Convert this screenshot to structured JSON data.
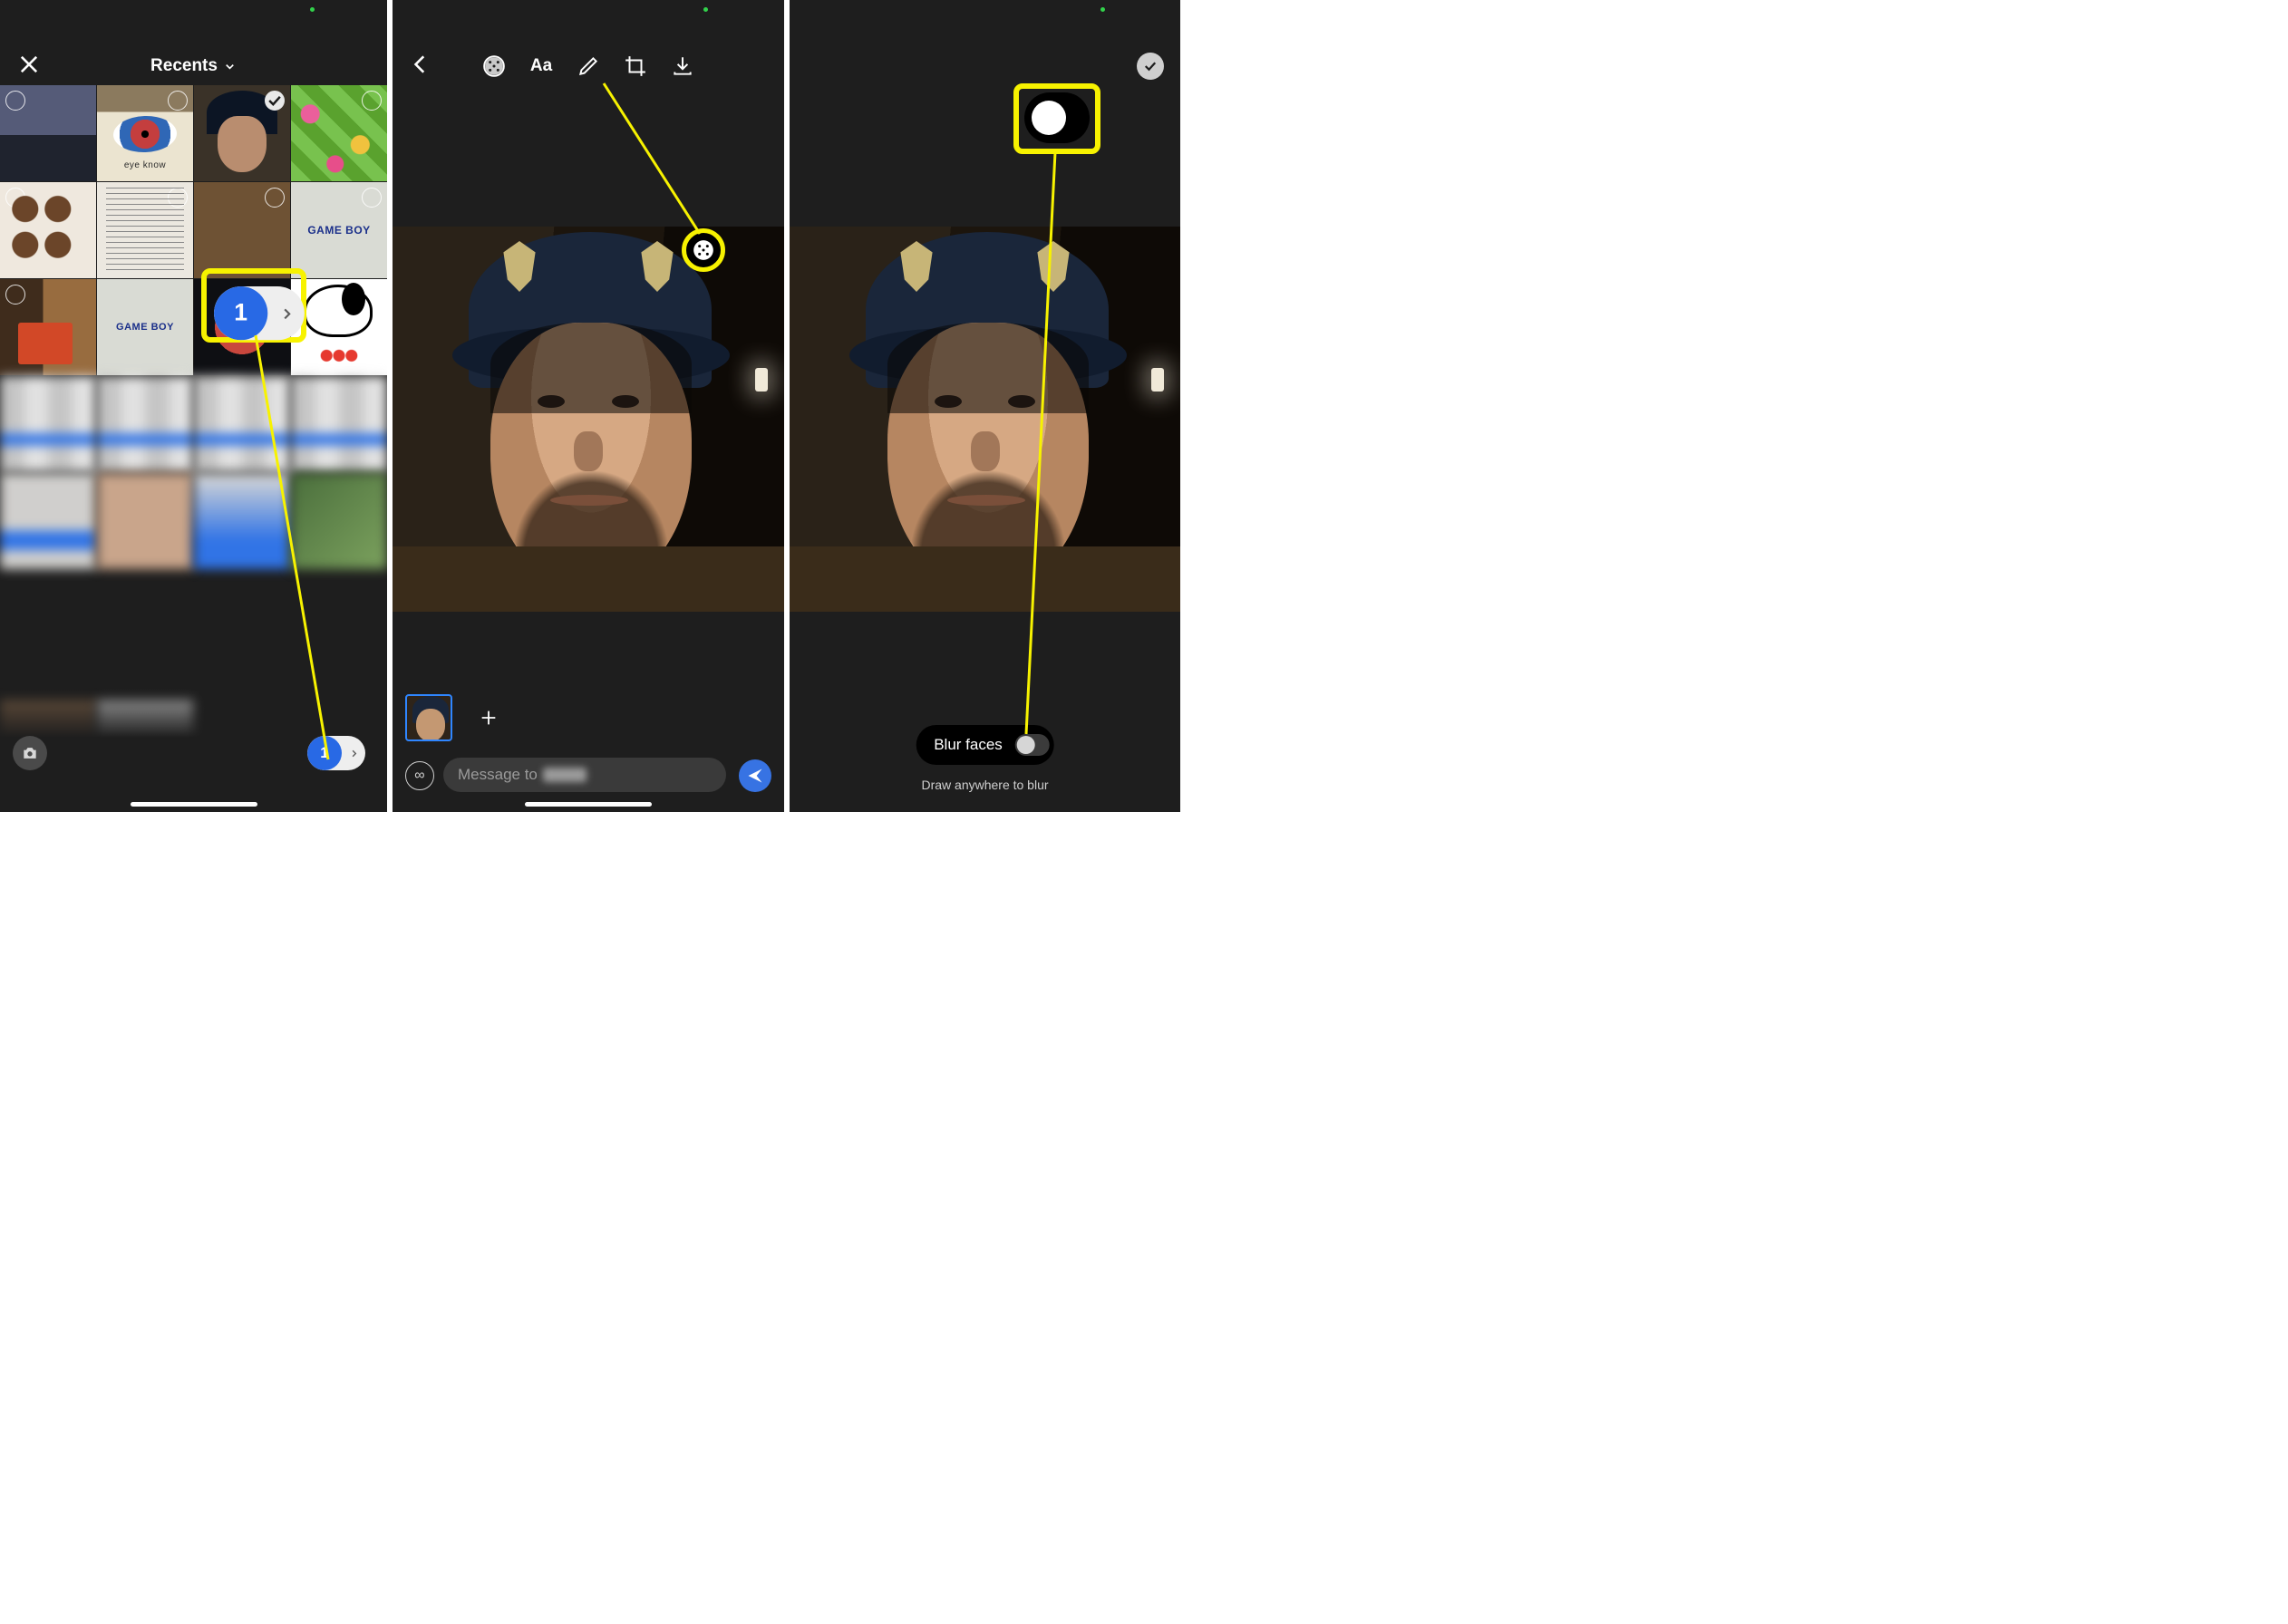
{
  "panel1": {
    "album_title": "Recents",
    "selected_count": "1",
    "tiles": [
      "eyebox",
      "eyeknow",
      "face",
      "blue",
      "pattern",
      "drink",
      "cakes",
      "menu",
      "food",
      "gameboy",
      "desk",
      "gameboy2",
      "snoopy",
      "b1",
      "b2",
      "b3",
      "b4",
      "b5",
      "b6",
      "b7",
      "b8",
      "collage"
    ],
    "eyeknow_label": "eye know",
    "gameboy_label": "GAME BOY"
  },
  "panel2": {
    "tools": [
      "blur",
      "text",
      "draw",
      "crop",
      "save"
    ],
    "message_prefix": "Message to"
  },
  "panel3": {
    "toggle_label": "Blur faces",
    "hint": "Draw anywhere to blur"
  },
  "annotations": {
    "highlight_color": "#f7f200"
  }
}
